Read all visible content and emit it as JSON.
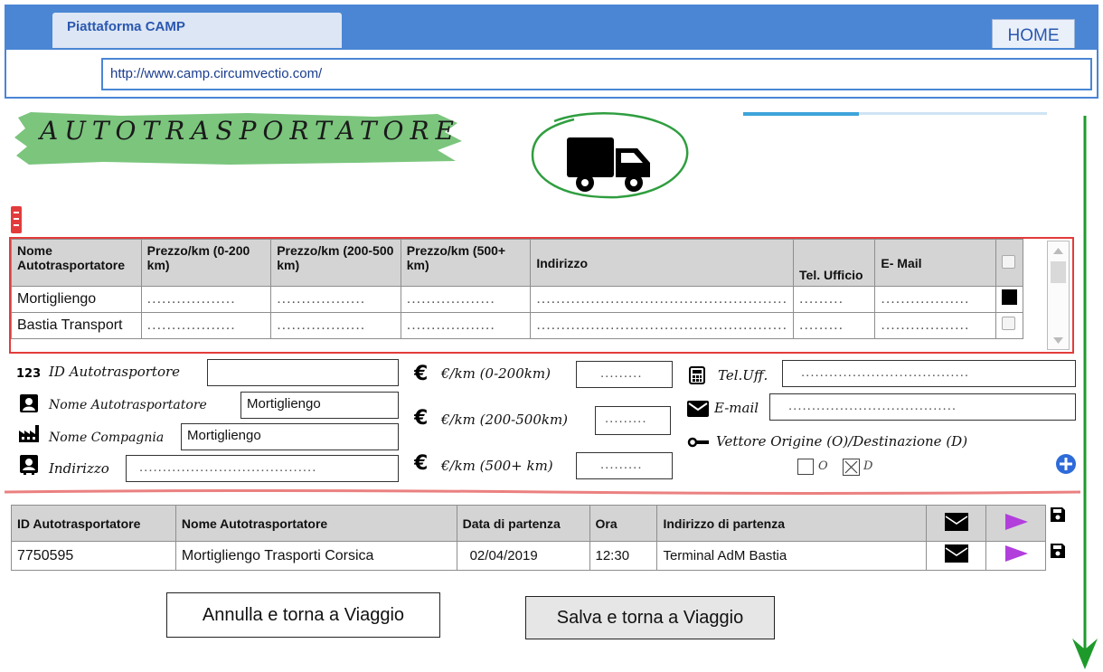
{
  "browser": {
    "tab_title": "Piattaforma CAMP",
    "home_label": "HOME",
    "url": "http://www.camp.circumvectio.com/"
  },
  "page": {
    "title": "AUTOTRASPORTATORE",
    "progress": 0.38
  },
  "carrier_table": {
    "headers": [
      "Nome Autotrasportatore",
      "Prezzo/km (0-200 km)",
      "Prezzo/km (200-500 km)",
      "Prezzo/km (500+ km)",
      "Indirizzo",
      "Tel. Ufficio",
      "E- Mail"
    ],
    "rows": [
      {
        "name": "Mortigliengo",
        "price1": "..................",
        "price2": "..................",
        "price3": "..................",
        "address": "...................................................",
        "tel": ".........",
        "email": "..................",
        "selected": true
      },
      {
        "name": "Bastia Transport",
        "price1": "..................",
        "price2": "..................",
        "price3": "..................",
        "address": "...................................................",
        "tel": ".........",
        "email": "..................",
        "selected": false
      }
    ]
  },
  "form": {
    "id_label": "ID Autotrasportore",
    "id_value": "",
    "name_label": "Nome Autotrasportatore",
    "name_value": "Mortigliengo",
    "company_label": "Nome Compagnia",
    "company_value": "Mortigliengo",
    "address_label": "Indirizzo",
    "address_value": "......................................",
    "price1_label": "€/km (0-200km)",
    "price1_value": ".........",
    "price2_label": "€/km (200-500km)",
    "price2_value": ".........",
    "price3_label": "€/km (500+ km)",
    "price3_value": ".........",
    "tel_label": "Tel.Uff.",
    "tel_value": "....................................",
    "email_label": "E-mail",
    "email_value": "....................................",
    "vector_label": "Vettore Origine (O)/Destinazione (D)",
    "origin_letter": "O",
    "dest_letter": "D"
  },
  "trip_table": {
    "headers": [
      "ID Autotrasportatore",
      "Nome Autotrasportatore",
      "Data di partenza",
      "Ora",
      "Indirizzo di partenza"
    ],
    "rows": [
      {
        "id": "7750595",
        "name": "Mortigliengo Trasporti Corsica",
        "date": "02/04/2019",
        "time": "12:30",
        "address": "Terminal AdM Bastia"
      }
    ]
  },
  "buttons": {
    "cancel": "Annulla e torna a Viaggio",
    "save": "Salva e torna a Viaggio"
  },
  "colors": {
    "chrome_blue": "#4a86d4",
    "accent_red": "#e33b3b",
    "brush_green": "#6dbf6f",
    "circle_green": "#2f9e3f",
    "play_purple": "#b23fdc",
    "arrow_green": "#1e9a2a"
  }
}
